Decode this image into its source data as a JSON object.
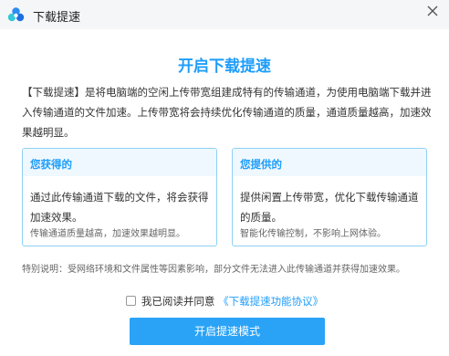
{
  "window": {
    "title": "下载提速"
  },
  "main": {
    "heading": "开启下载提速",
    "description": "【下载提速】是将电脑端的空闲上传带宽组建成特有的传输通道，为使用电脑端下载并进入传输通道的文件加速。上传带宽将会持续优化传输通道的质量，通道质量越高，加速效果越明显。"
  },
  "cards": [
    {
      "title": "您获得的",
      "body": "通过此传输通道下载的文件，将会获得加速效果。",
      "note": "传输通道质量越高，加速效果越明显。"
    },
    {
      "title": "您提供的",
      "body": "提供闲置上传带宽，优化下载传输通道的质量。",
      "note": "智能化传输控制，不影响上网体验。"
    }
  ],
  "special_note": "特别说明：受网络环境和文件属性等因素影响，部分文件无法进入此传输通道并获得加速效果。",
  "agreement": {
    "prefix": "我已阅读并同意",
    "link_text": "《下载提速功能协议》",
    "checked": false
  },
  "button": {
    "label": "开启提速模式"
  },
  "colors": {
    "accent": "#1e9dfa",
    "button": "#2aa3f7",
    "card_border": "#8fd0f5",
    "card_header_bg": "#eef8fe"
  },
  "icons": {
    "logo": "cloud-logo-icon",
    "close": "close-icon"
  }
}
